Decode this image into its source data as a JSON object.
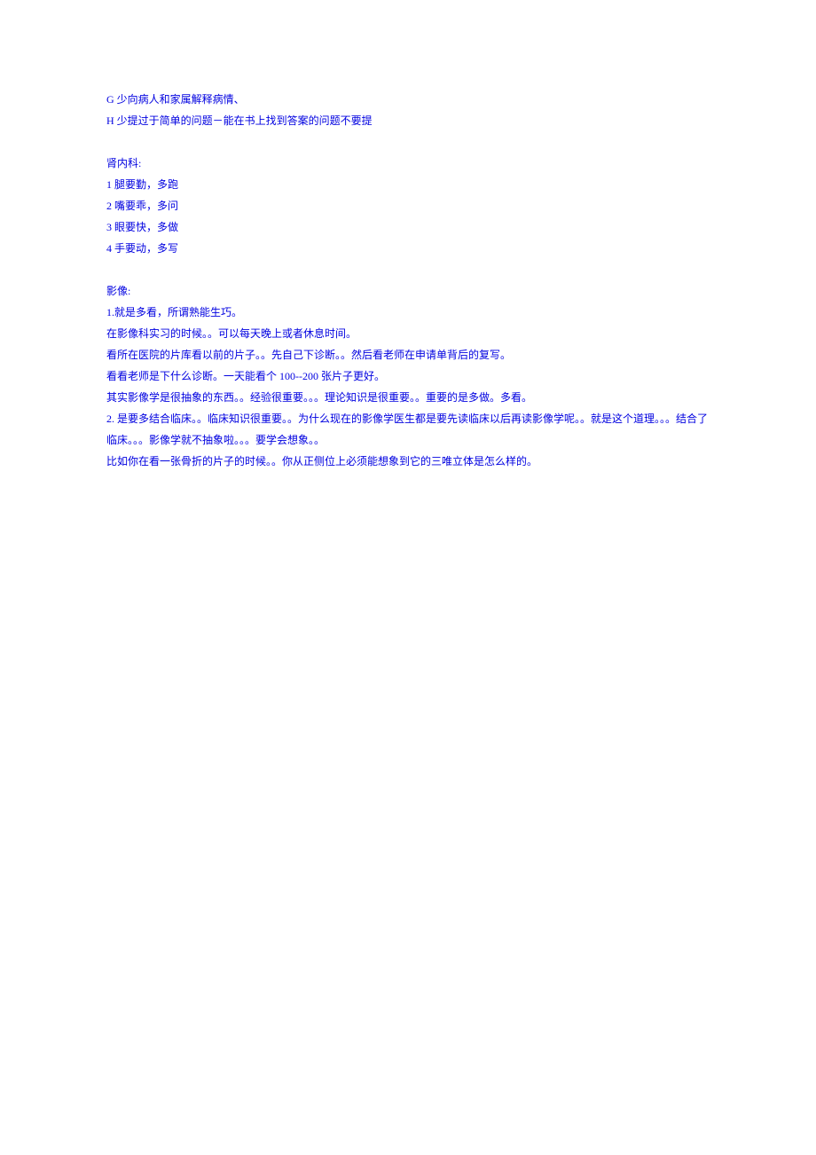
{
  "lines": [
    "G 少向病人和家属解释病情、",
    "H 少提过于简单的问题－能在书上找到答案的问题不要提",
    "",
    "肾内科:",
    "1 腿要勤，多跑",
    "2 嘴要乖，多问",
    "3 眼要快，多做",
    "4 手要动，多写",
    "",
    "影像:",
    "1.就是多看，所谓熟能生巧。",
    "在影像科实习的时候。。可以每天晚上或者休息时间。",
    "看所在医院的片库看以前的片子。。先自己下诊断。。然后看老师在申请单背后的复写。",
    "看看老师是下什么诊断。一天能看个 100--200 张片子更好。",
    "其实影像学是很抽象的东西。。经验很重要。。。理论知识是很重要。。重要的是多做。多看。",
    "2. 是要多结合临床。。临床知识很重要。。为什么现在的影像学医生都是要先读临床以后再读影像学呢。。就是这个道理。。。结合了临床。。。影像学就不抽象啦。。。要学会想象。。",
    "比如你在看一张骨折的片子的时候。。你从正侧位上必须能想象到它的三唯立体是怎么样的。"
  ]
}
